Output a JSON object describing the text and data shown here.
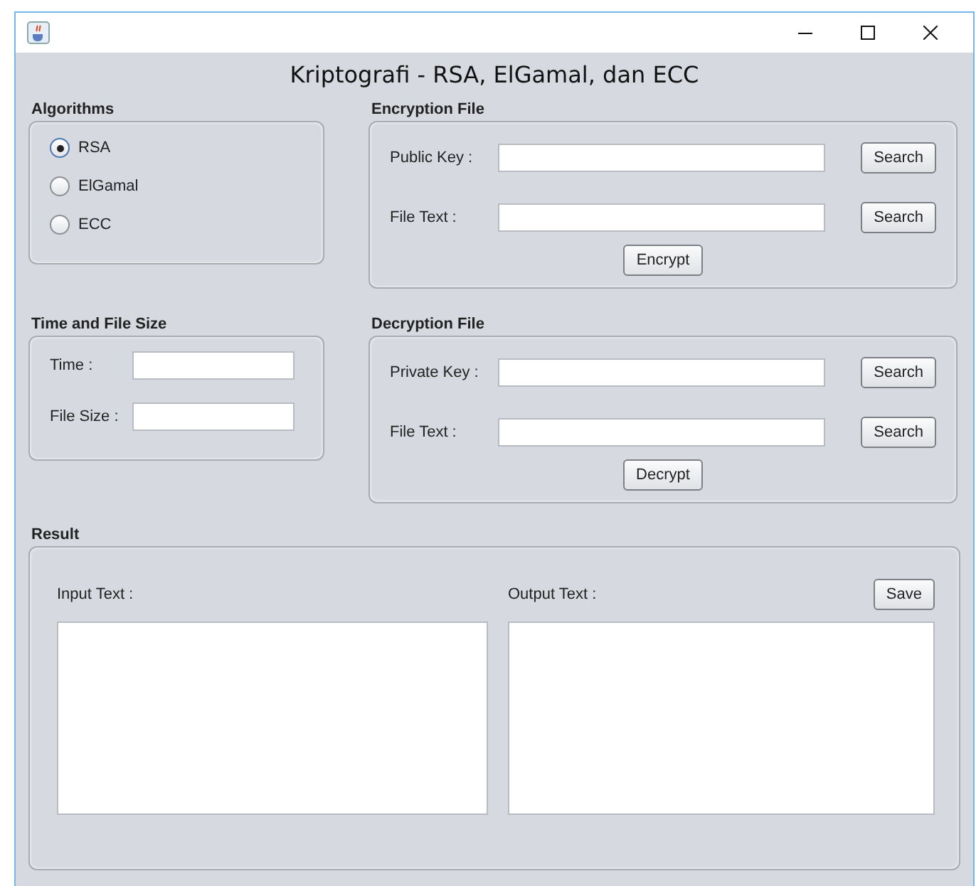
{
  "window": {
    "heading": "Kriptografi - RSA, ElGamal, dan ECC"
  },
  "algorithms": {
    "label": "Algorithms",
    "options": [
      {
        "label": "RSA",
        "selected": true
      },
      {
        "label": "ElGamal",
        "selected": false
      },
      {
        "label": "ECC",
        "selected": false
      }
    ]
  },
  "encryption": {
    "label": "Encryption File",
    "fields": [
      {
        "label": "Public Key :",
        "button": "Search"
      },
      {
        "label": "File Text :",
        "button": "Search"
      }
    ],
    "action": "Encrypt"
  },
  "time_size": {
    "label": "Time and File Size",
    "fields": [
      {
        "label": "Time :"
      },
      {
        "label": "File Size :"
      }
    ]
  },
  "decryption": {
    "label": "Decryption File",
    "fields": [
      {
        "label": "Private Key :",
        "button": "Search"
      },
      {
        "label": "File Text :",
        "button": "Search"
      }
    ],
    "action": "Decrypt"
  },
  "result": {
    "label": "Result",
    "input_label": "Input Text :",
    "output_label": "Output Text :",
    "save": "Save"
  }
}
